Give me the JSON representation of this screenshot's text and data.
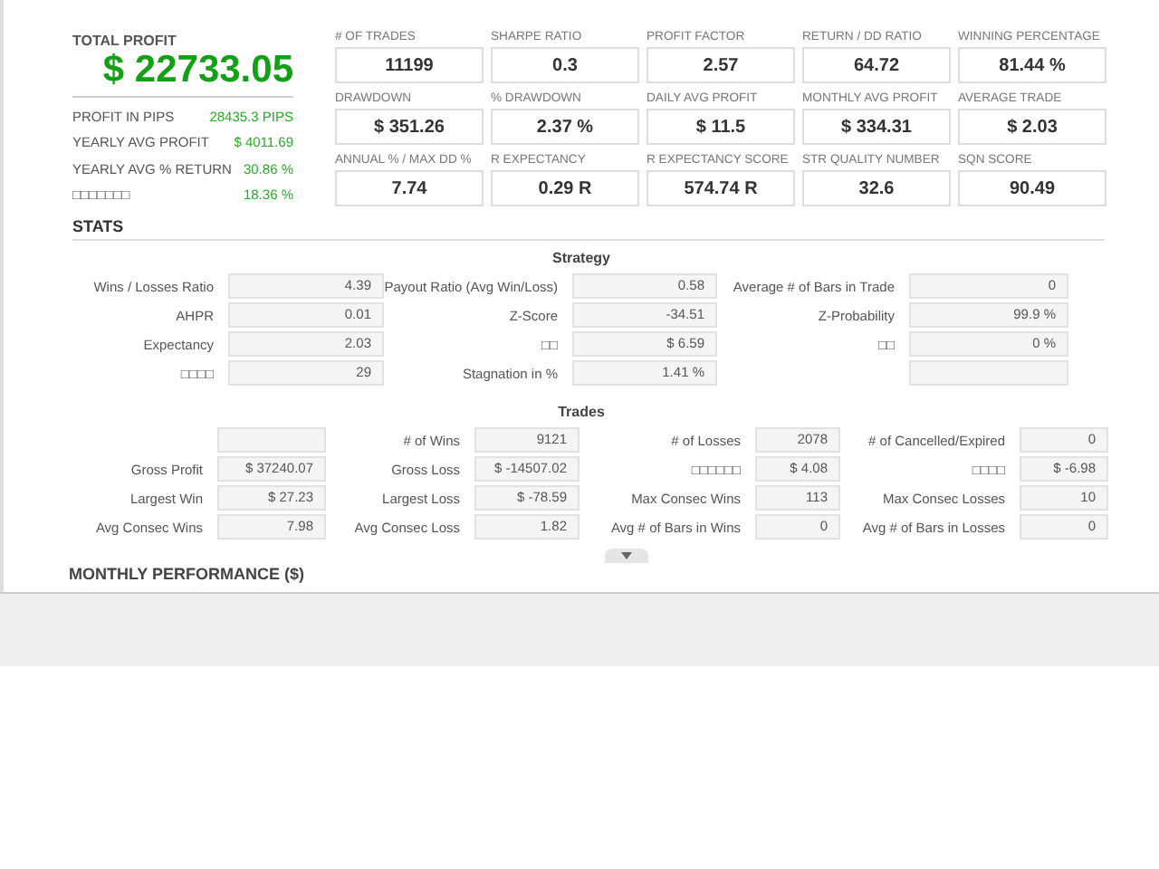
{
  "summary": {
    "title": "TOTAL PROFIT",
    "value": "$ 22733.05",
    "rows": [
      {
        "label": "PROFIT IN PIPS",
        "value": "28435.3 PIPS"
      },
      {
        "label": "YEARLY AVG PROFIT",
        "value": "$ 4011.69"
      },
      {
        "label": "YEARLY AVG % RETURN",
        "value": "30.86 %"
      },
      {
        "label": "□□□□□□□",
        "value": "18.36 %"
      }
    ]
  },
  "metrics": [
    {
      "label": "# OF TRADES",
      "value": "11199"
    },
    {
      "label": "SHARPE RATIO",
      "value": "0.3"
    },
    {
      "label": "PROFIT FACTOR",
      "value": "2.57"
    },
    {
      "label": "RETURN / DD RATIO",
      "value": "64.72"
    },
    {
      "label": "WINNING PERCENTAGE",
      "value": "81.44 %"
    },
    {
      "label": "DRAWDOWN",
      "value": "$ 351.26"
    },
    {
      "label": "% DRAWDOWN",
      "value": "2.37 %"
    },
    {
      "label": "DAILY AVG PROFIT",
      "value": "$ 11.5"
    },
    {
      "label": "MONTHLY AVG PROFIT",
      "value": "$ 334.31"
    },
    {
      "label": "AVERAGE TRADE",
      "value": "$ 2.03"
    },
    {
      "label": "ANNUAL % / MAX DD %",
      "value": "7.74"
    },
    {
      "label": "R EXPECTANCY",
      "value": "0.29 R"
    },
    {
      "label": "R EXPECTANCY SCORE",
      "value": "574.74 R"
    },
    {
      "label": "STR QUALITY NUMBER",
      "value": "32.6"
    },
    {
      "label": "SQN SCORE",
      "value": "90.49"
    }
  ],
  "stats": {
    "title": "STATS",
    "strategy": {
      "title": "Strategy",
      "cells": [
        {
          "kind": "metric",
          "label": "Wins / Losses Ratio",
          "value": "4.39"
        },
        {
          "kind": "metric",
          "label": "Payout Ratio (Avg Win/Loss)",
          "value": "0.58"
        },
        {
          "kind": "metric",
          "label": "Average # of Bars in Trade",
          "value": "0"
        },
        {
          "kind": "metric",
          "label": "AHPR",
          "value": "0.01"
        },
        {
          "kind": "metric",
          "label": "Z-Score",
          "value": "-34.51"
        },
        {
          "kind": "metric",
          "label": "Z-Probability",
          "value": "99.9 %"
        },
        {
          "kind": "metric",
          "label": "Expectancy",
          "value": "2.03"
        },
        {
          "kind": "metric",
          "label": "□□",
          "value": "$ 6.59"
        },
        {
          "kind": "metric",
          "label": "□□",
          "value": "0 %"
        },
        {
          "kind": "metric",
          "label": "□□□□",
          "value": "29"
        },
        {
          "kind": "metric",
          "label": "Stagnation in %",
          "value": "1.41 %"
        },
        {
          "kind": "blank"
        }
      ]
    },
    "trades": {
      "title": "Trades",
      "cells": [
        {
          "kind": "blank"
        },
        {
          "kind": "metric",
          "label": "# of Wins",
          "value": "9121"
        },
        {
          "kind": "metric",
          "label": "# of Losses",
          "value": "2078"
        },
        {
          "kind": "metric",
          "label": "# of Cancelled/Expired",
          "value": "0"
        },
        {
          "kind": "metric",
          "label": "Gross Profit",
          "value": "$ 37240.07"
        },
        {
          "kind": "metric",
          "label": "Gross Loss",
          "value": "$ -14507.02"
        },
        {
          "kind": "metric",
          "label": "□□□□□□",
          "value": "$ 4.08"
        },
        {
          "kind": "metric",
          "label": "□□□□",
          "value": "$ -6.98"
        },
        {
          "kind": "metric",
          "label": "Largest Win",
          "value": "$ 27.23"
        },
        {
          "kind": "metric",
          "label": "Largest Loss",
          "value": "$ -78.59"
        },
        {
          "kind": "metric",
          "label": "Max Consec Wins",
          "value": "113"
        },
        {
          "kind": "metric",
          "label": "Max Consec Losses",
          "value": "10"
        },
        {
          "kind": "metric",
          "label": "Avg Consec Wins",
          "value": "7.98"
        },
        {
          "kind": "metric",
          "label": "Avg Consec Loss",
          "value": "1.82"
        },
        {
          "kind": "metric",
          "label": "Avg # of Bars in Wins",
          "value": "0"
        },
        {
          "kind": "metric",
          "label": "Avg # of Bars in Losses",
          "value": "0"
        }
      ]
    }
  },
  "monthly": {
    "title": "MONTHLY PERFORMANCE ($)"
  }
}
